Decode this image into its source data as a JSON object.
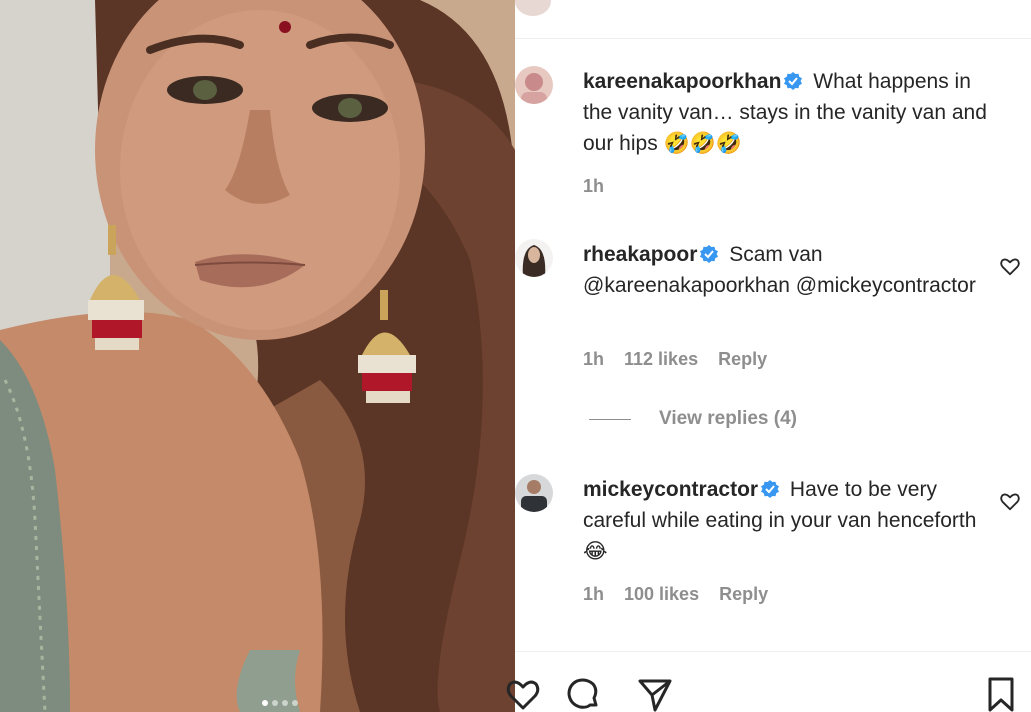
{
  "post": {
    "image_alt": "",
    "carousel": {
      "count": 4,
      "active": 0
    }
  },
  "comments": [
    {
      "username": "kareenakapoorkhan",
      "verified": true,
      "text": "What happens in the vanity van… stays in the vanity van and our hips 🤣🤣🤣",
      "time": "1h",
      "likes": "",
      "reply": "",
      "avatar_color": "#e7c9c2",
      "has_heart": false
    },
    {
      "username": "rheakapoor",
      "verified": true,
      "text": "Scam van @kareenakapoorkhan @mickeycontractor",
      "time": "1h",
      "likes": "112 likes",
      "reply": "Reply",
      "avatar_color": "#3a2b25",
      "has_heart": true
    },
    {
      "username": "mickeycontractor",
      "verified": true,
      "text": "Have to be very careful while eating in your van henceforth 😂",
      "time": "1h",
      "likes": "100 likes",
      "reply": "Reply",
      "avatar_color": "#55585c",
      "has_heart": true
    }
  ],
  "view_replies": "View replies (4)",
  "actions": {
    "like": "heart-icon",
    "comment": "comment-icon",
    "share": "share-icon",
    "save": "bookmark-icon"
  },
  "colors": {
    "verified": "#3897f0",
    "muted": "#8e8e8e",
    "text": "#262626"
  }
}
